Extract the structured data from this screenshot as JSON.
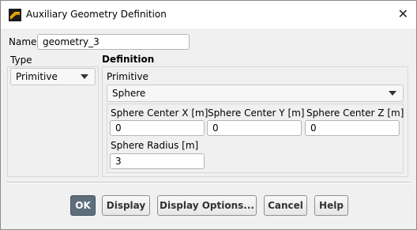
{
  "window": {
    "title": "Auxiliary Geometry Definition",
    "close_glyph": "✕"
  },
  "name": {
    "label": "Name",
    "value": "geometry_3"
  },
  "type": {
    "label": "Type",
    "selected": "Primitive"
  },
  "definition": {
    "heading": "Definition",
    "primitive_label": "Primitive",
    "primitive_selected": "Sphere",
    "center_x": {
      "label": "Sphere Center X [m]",
      "value": "0"
    },
    "center_y": {
      "label": "Sphere Center Y [m]",
      "value": "0"
    },
    "center_z": {
      "label": "Sphere Center Z [m]",
      "value": "0"
    },
    "radius": {
      "label": "Sphere Radius [m]",
      "value": "3"
    }
  },
  "buttons": {
    "ok": "OK",
    "display": "Display",
    "display_options": "Display Options...",
    "cancel": "Cancel",
    "help": "Help"
  },
  "icons": {
    "app": "ansys-logo-icon",
    "close": "close-icon",
    "dropdown": "chevron-down-icon"
  },
  "colors": {
    "primary_button": "#5e6e7d",
    "window_bg": "#f0f0f0"
  }
}
